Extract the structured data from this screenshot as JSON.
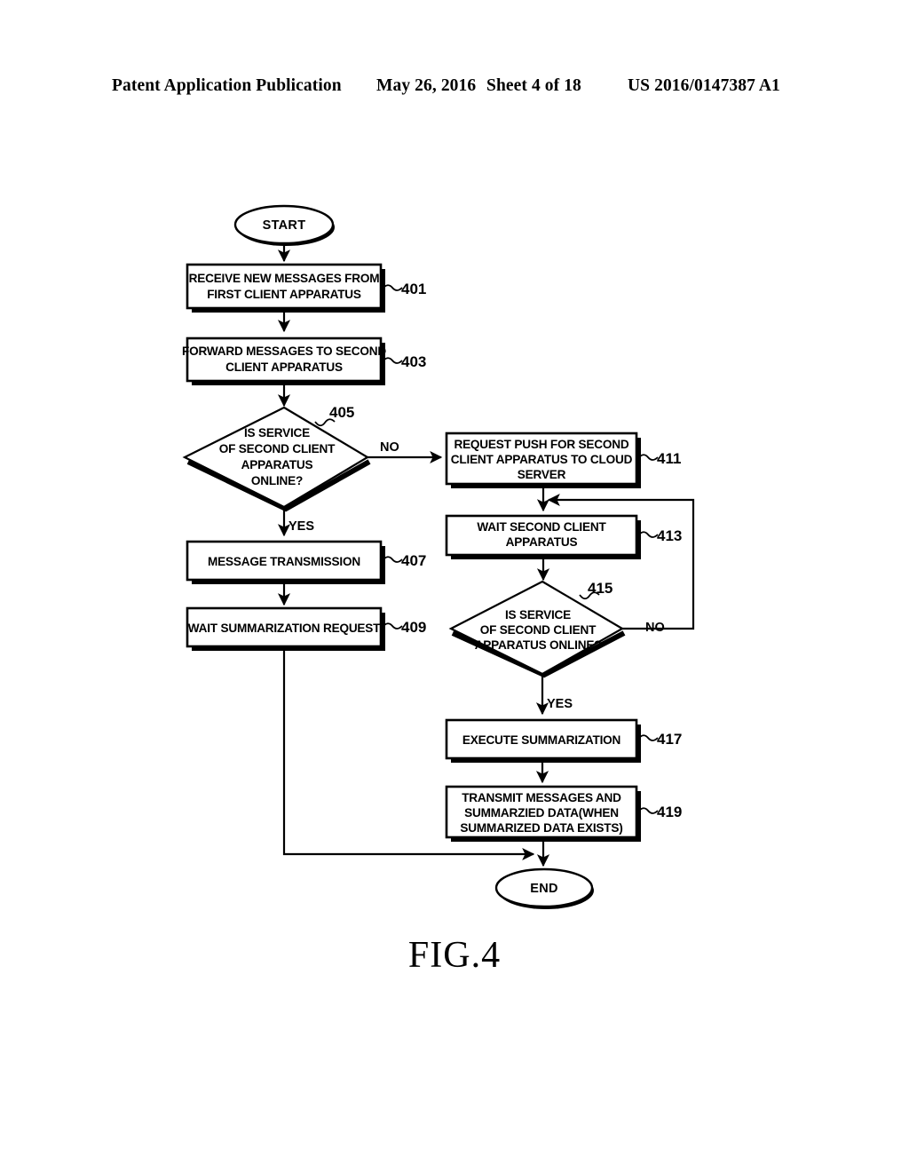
{
  "header": {
    "title": "Patent Application Publication",
    "date": "May 26, 2016",
    "sheet": "Sheet 4 of 18",
    "publication_number": "US 2016/0147387 A1"
  },
  "figure": {
    "caption": "FIG.4"
  },
  "flowchart": {
    "start": {
      "label": "START"
    },
    "end": {
      "label": "END"
    },
    "branch_labels": {
      "no_405": "NO",
      "yes_405": "YES",
      "no_415": "NO",
      "yes_415": "YES"
    },
    "nodes": [
      {
        "ref": "401",
        "type": "process",
        "lines": [
          "RECEIVE NEW MESSAGES FROM",
          "FIRST CLIENT APPARATUS"
        ]
      },
      {
        "ref": "403",
        "type": "process",
        "lines": [
          "FORWARD MESSAGES TO SECOND",
          "CLIENT APPARATUS"
        ]
      },
      {
        "ref": "405",
        "type": "decision",
        "lines": [
          "IS SERVICE",
          "OF SECOND CLIENT",
          "APPARATUS",
          "ONLINE?"
        ]
      },
      {
        "ref": "407",
        "type": "process",
        "lines": [
          "MESSAGE TRANSMISSION"
        ]
      },
      {
        "ref": "409",
        "type": "process",
        "lines": [
          "WAIT SUMMARIZATION REQUEST"
        ]
      },
      {
        "ref": "411",
        "type": "process",
        "lines": [
          "REQUEST PUSH FOR SECOND",
          "CLIENT APPARATUS TO CLOUD",
          "SERVER"
        ]
      },
      {
        "ref": "413",
        "type": "process",
        "lines": [
          "WAIT SECOND CLIENT",
          "APPARATUS"
        ]
      },
      {
        "ref": "415",
        "type": "decision",
        "lines": [
          "IS SERVICE",
          "OF SECOND CLIENT",
          "APPARATUS ONLINE?"
        ]
      },
      {
        "ref": "417",
        "type": "process",
        "lines": [
          "EXECUTE SUMMARIZATION"
        ]
      },
      {
        "ref": "419",
        "type": "process",
        "lines": [
          "TRANSMIT MESSAGES AND",
          "SUMMARZIED DATA(WHEN",
          "SUMMARIZED DATA EXISTS)"
        ]
      }
    ]
  },
  "colors": {
    "ink": "#000000",
    "paper": "#ffffff"
  }
}
